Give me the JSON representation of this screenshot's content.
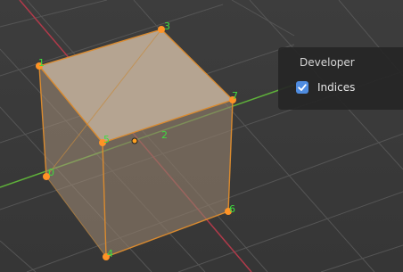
{
  "viewport": {
    "vertex_indices": [
      "0",
      "1",
      "2",
      "3",
      "4",
      "5",
      "6",
      "7"
    ],
    "face_index_label": "2"
  },
  "overlay_panel": {
    "title": "Developer",
    "indices_label": "Indices",
    "indices_checked": true
  },
  "colors": {
    "background": "#3a3a3a",
    "x_axis": "#b13a4a",
    "y_axis": "#5fb13a",
    "vertex": "#ff9326",
    "index_text": "#3fdc3f",
    "checkbox": "#4f8ce0"
  }
}
